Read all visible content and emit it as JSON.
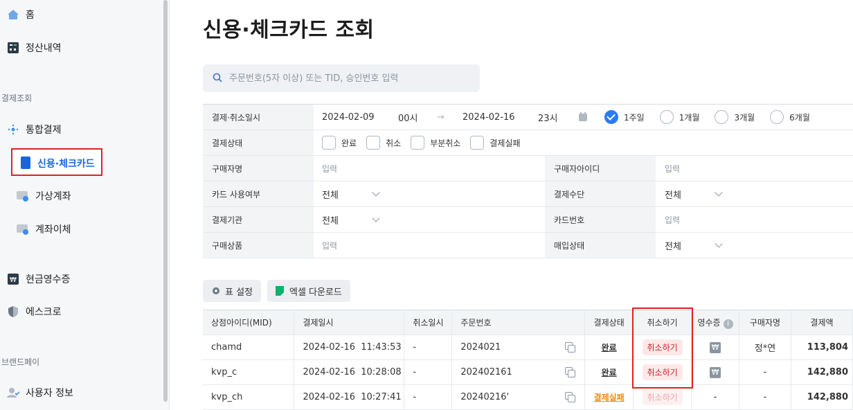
{
  "sidebar": {
    "home": "홈",
    "settlement": "정산내역",
    "section_payment": "결제조회",
    "integrated": "통합결제",
    "card": "신용·체크카드",
    "virtual_account": "가상계좌",
    "transfer": "계좌이체",
    "cash_receipt": "현금영수증",
    "escrow": "에스크로",
    "section_brandpay": "브랜드페이",
    "user_info": "사용자 정보"
  },
  "page": {
    "title": "신용·체크카드 조회",
    "search_placeholder": "주문번호(5자 이상) 또는 TID, 승인번호 입력"
  },
  "filters": {
    "date_label": "결제·취소일시",
    "start_date": "2024-02-09",
    "start_hour": "00시",
    "arrow": "→",
    "end_date": "2024-02-16",
    "end_hour": "23시",
    "ranges": [
      "1주일",
      "1개월",
      "3개월",
      "6개월"
    ],
    "selected_range": "1주일",
    "status_label": "결제상태",
    "statuses": [
      "완료",
      "취소",
      "부분취소",
      "결제실패"
    ],
    "buyer_name_label": "구매자명",
    "buyer_id_label": "구매자아이디",
    "input_placeholder": "입력",
    "card_use_label": "카드 사용여부",
    "payment_method_label": "결제수단",
    "issuer_label": "결제기관",
    "card_number_label": "카드번호",
    "product_label": "구매상품",
    "purchase_status_label": "매입상태",
    "all": "전체"
  },
  "toolbar": {
    "table_settings": "표 설정",
    "excel_download": "엑셀 다운로드"
  },
  "table": {
    "headers": [
      "상점아이디(MID)",
      "결제일시",
      "취소일시",
      "주문번호",
      "결제상태",
      "취소하기",
      "영수증",
      "구매자명",
      "결제액"
    ],
    "rows": [
      {
        "mid": "chamd",
        "paid_at": "2024-02-16  11:43:53",
        "cancelled_at": "-",
        "order_no": "2024021",
        "status": "완료",
        "cancel": "취소하기",
        "receipt": "₩",
        "buyer": "정*연",
        "amount": "113,804"
      },
      {
        "mid": "kvp_c",
        "paid_at": "2024-02-16  10:28:08",
        "cancelled_at": "-",
        "order_no": "202402161",
        "status": "완료",
        "cancel": "취소하기",
        "receipt": "₩",
        "buyer": "-",
        "amount": "142,880"
      },
      {
        "mid": "kvp_ch",
        "paid_at": "2024-02-16  10:27:41",
        "cancelled_at": "-",
        "order_no": "20240216'",
        "status": "결제실패",
        "cancel": "취소하기",
        "receipt": "-",
        "buyer": "-",
        "amount": "142,880"
      }
    ]
  },
  "colors": {
    "accent": "#1b64da",
    "highlight_border": "#e02020",
    "fail": "#f28c0c"
  }
}
